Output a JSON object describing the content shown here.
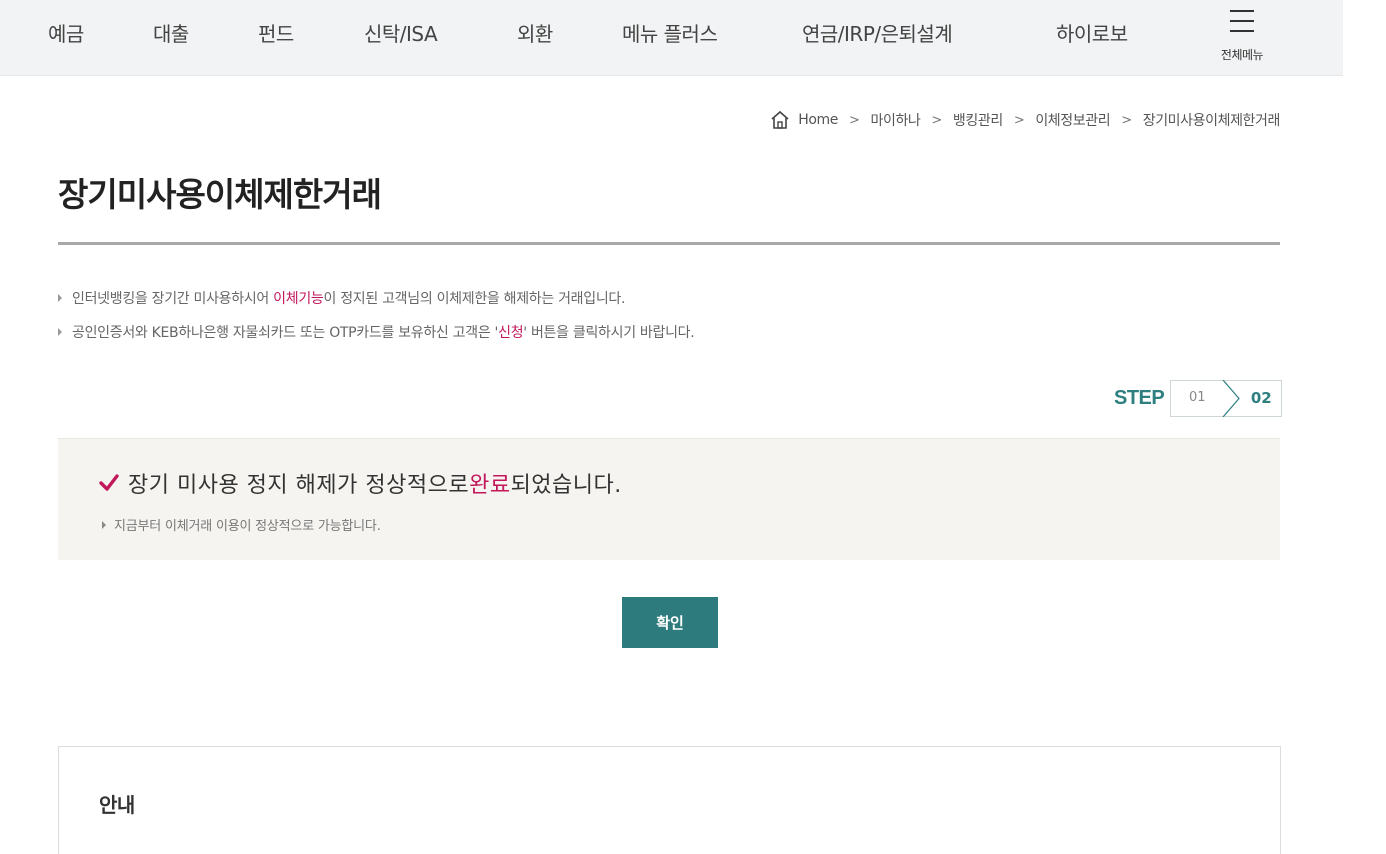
{
  "nav": {
    "items": [
      "예금",
      "대출",
      "펀드",
      "신탁/ISA",
      "외환",
      "메뉴 플러스",
      "연금/IRP/은퇴설계",
      "하이로보"
    ],
    "all_menu_label": "전체메뉴"
  },
  "breadcrumb": {
    "home": "Home",
    "items": [
      "마이하나",
      "뱅킹관리",
      "이체정보관리",
      "장기미사용이체제한거래"
    ],
    "separator": ">"
  },
  "page": {
    "title": "장기미사용이체제한거래"
  },
  "notices": [
    {
      "before": "인터넷뱅킹을 장기간 미사용하시어 ",
      "highlight": "이체기능",
      "after": "이 정지된 고객님의 이체제한을 해제하는 거래입니다."
    },
    {
      "before": "공인인증서와 KEB하나은행 자물쇠카드 또는 OTP카드를 보유하신 고객은 '",
      "highlight": "신청",
      "after": "' 버튼을 클릭하시기 바랍니다."
    }
  ],
  "step": {
    "label": "STEP",
    "steps": [
      "01",
      "02"
    ],
    "current": "02"
  },
  "result": {
    "message_before": "장기 미사용 정지 해제가 정상적으로 ",
    "message_highlight": "완료",
    "message_after": "되었습니다.",
    "sub": "지금부터 이체거래 이용이 정상적으로 가능합니다."
  },
  "confirm_label": "확인",
  "guide": {
    "title": "안내"
  },
  "colors": {
    "accent_teal": "#2e7b7d",
    "highlight_pink": "#c2185b",
    "nav_bg": "#f2f3f4",
    "panel_bg": "#f5f4f0"
  },
  "icons": {
    "home": "home-icon",
    "menu": "hamburger-icon",
    "check": "check-icon",
    "step_arrow": "chevron-right-icon"
  }
}
